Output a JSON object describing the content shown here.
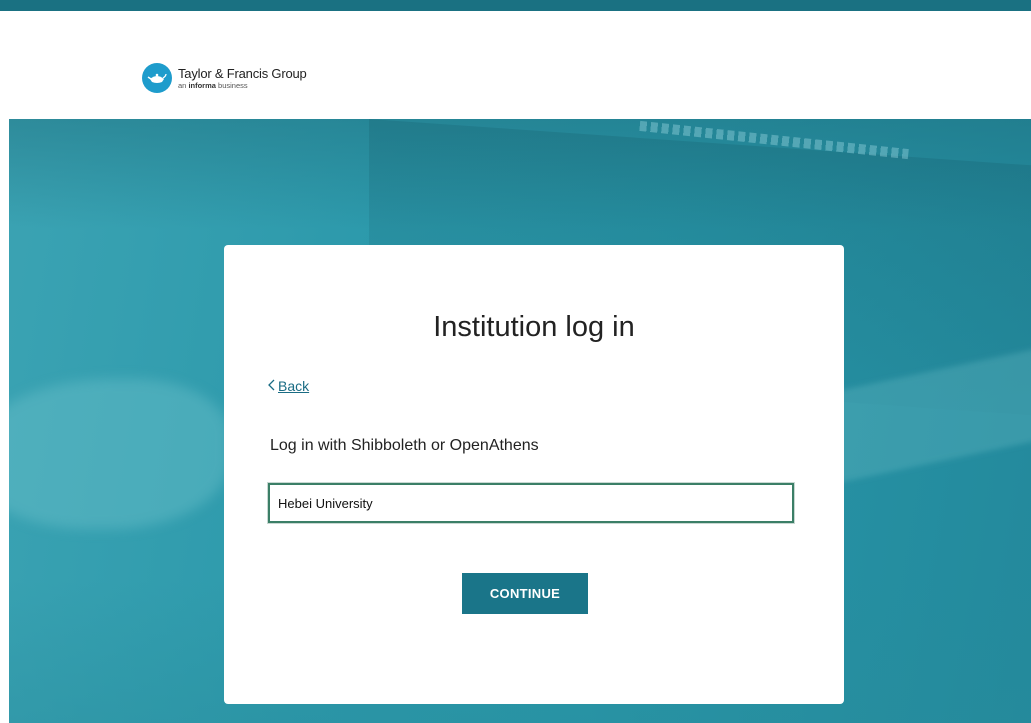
{
  "header": {
    "logo_title": "Taylor & Francis Group",
    "logo_sub_prefix": "an",
    "logo_sub_brand": "informa",
    "logo_sub_suffix": "business",
    "brand_color": "#1e9ccc",
    "top_bar_color": "#1a7182"
  },
  "card": {
    "title": "Institution log in",
    "back_label": "Back",
    "back_icon": "chevron-left-icon",
    "login_label": "Log in with Shibboleth or OpenAthens",
    "input_value": "Hebei University",
    "continue_label": "CONTINUE",
    "button_color": "#1a7589"
  }
}
